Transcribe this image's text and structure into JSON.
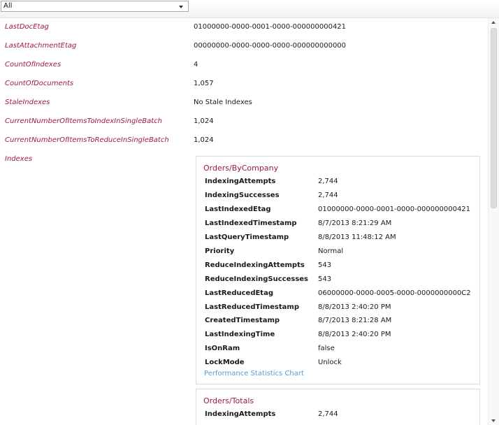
{
  "filter": {
    "selected": "All"
  },
  "properties": [
    {
      "label": "LastDocEtag",
      "value": "01000000-0000-0001-0000-000000000421"
    },
    {
      "label": "LastAttachmentEtag",
      "value": "00000000-0000-0000-0000-000000000000"
    },
    {
      "label": "CountOfIndexes",
      "value": "4"
    },
    {
      "label": "CountOfDocuments",
      "value": "1,057"
    },
    {
      "label": "StaleIndexes",
      "value": "No Stale Indexes"
    },
    {
      "label": "CurrentNumberOfItemsToIndexInSingleBatch",
      "value": "1,024"
    },
    {
      "label": "CurrentNumberOfItemsToReduceInSingleBatch",
      "value": "1,024"
    }
  ],
  "indexes_label": "Indexes",
  "indexes": [
    {
      "name": "Orders/ByCompany",
      "stats": [
        {
          "label": "IndexingAttempts",
          "value": "2,744"
        },
        {
          "label": "IndexingSuccesses",
          "value": "2,744"
        },
        {
          "label": "LastIndexedEtag",
          "value": "01000000-0000-0001-0000-000000000421"
        },
        {
          "label": "LastIndexedTimestamp",
          "value": "8/7/2013 8:21:29 AM"
        },
        {
          "label": "LastQueryTimestamp",
          "value": "8/8/2013 11:48:12 AM"
        },
        {
          "label": "Priority",
          "value": "Normal"
        },
        {
          "label": "ReduceIndexingAttempts",
          "value": "543"
        },
        {
          "label": "ReduceIndexingSuccesses",
          "value": "543"
        },
        {
          "label": "LastReducedEtag",
          "value": "06000000-0000-0005-0000-0000000000C2"
        },
        {
          "label": "LastReducedTimestamp",
          "value": "8/8/2013 2:40:20 PM"
        },
        {
          "label": "CreatedTimestamp",
          "value": "8/7/2013 8:21:28 AM"
        },
        {
          "label": "LastIndexingTime",
          "value": "8/8/2013 2:40:20 PM"
        },
        {
          "label": "IsOnRam",
          "value": "false"
        },
        {
          "label": "LockMode",
          "value": "Unlock"
        }
      ],
      "link": "Performance Statistics Chart"
    },
    {
      "name": "Orders/Totals",
      "stats": [
        {
          "label": "IndexingAttempts",
          "value": "2,744"
        }
      ]
    }
  ]
}
